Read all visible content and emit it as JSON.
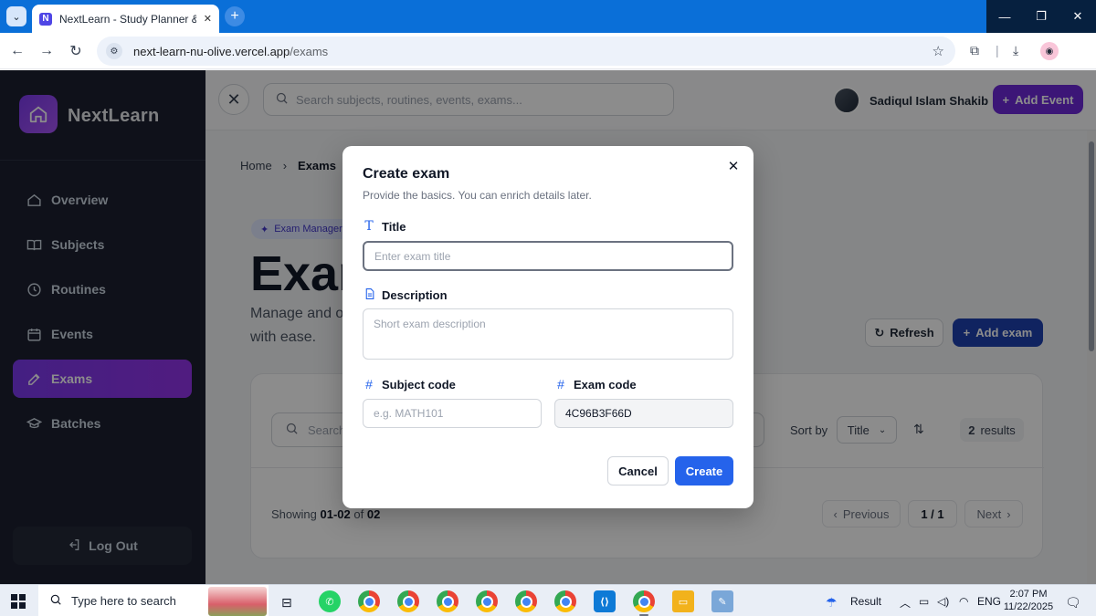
{
  "browser": {
    "tab_title": "NextLearn - Study Planner & Ro",
    "tab_favicon": "N",
    "url_host": "next-learn-nu-olive.vercel.app",
    "url_path": "/exams"
  },
  "app": {
    "brand": "NextLearn",
    "colors": {
      "accent": "#7c3aed",
      "primary": "#2563eb",
      "sidebar": "#1c2030"
    },
    "sidebar": {
      "items": [
        {
          "label": "Overview",
          "icon": "home-icon"
        },
        {
          "label": "Subjects",
          "icon": "book-icon"
        },
        {
          "label": "Routines",
          "icon": "clock-icon"
        },
        {
          "label": "Events",
          "icon": "calendar-icon"
        },
        {
          "label": "Exams",
          "icon": "pencil-icon",
          "active": true
        },
        {
          "label": "Batches",
          "icon": "graduation-cap-icon"
        }
      ],
      "logout_label": "Log Out"
    },
    "topbar": {
      "search_placeholder": "Search subjects, routines, events, exams...",
      "user_name": "Sadiqul Islam Shakib",
      "add_event_label": "Add Event"
    },
    "breadcrumb": {
      "home": "Home",
      "current": "Exams"
    },
    "pill_label": "Exam Manager",
    "page_title": "Exam",
    "page_lead": "Manage and o with ease.",
    "refresh_label": "Refresh",
    "add_exam_label": "Add exam",
    "list": {
      "search_placeholder": "Search",
      "sort_by_label": "Sort by",
      "sort_value": "Title",
      "results_count": "2",
      "results_label": "results",
      "showing_prefix": "Showing",
      "showing_range": "01-02",
      "showing_of": "of",
      "showing_total": "02",
      "previous_label": "Previous",
      "page_indicator": "1 / 1",
      "next_label": "Next"
    }
  },
  "modal": {
    "title": "Create exam",
    "subtitle": "Provide the basics. You can enrich details later.",
    "fields": {
      "title_label": "Title",
      "title_placeholder": "Enter exam title",
      "description_label": "Description",
      "description_placeholder": "Short exam description",
      "subject_code_label": "Subject code",
      "subject_code_placeholder": "e.g. MATH101",
      "exam_code_label": "Exam code",
      "exam_code_value": "4C96B3F66D"
    },
    "cancel_label": "Cancel",
    "create_label": "Create"
  },
  "taskbar": {
    "search_placeholder": "Type here to search",
    "weather_label": "Result",
    "language": "ENG",
    "time": "2:07 PM",
    "date": "11/22/2025"
  }
}
